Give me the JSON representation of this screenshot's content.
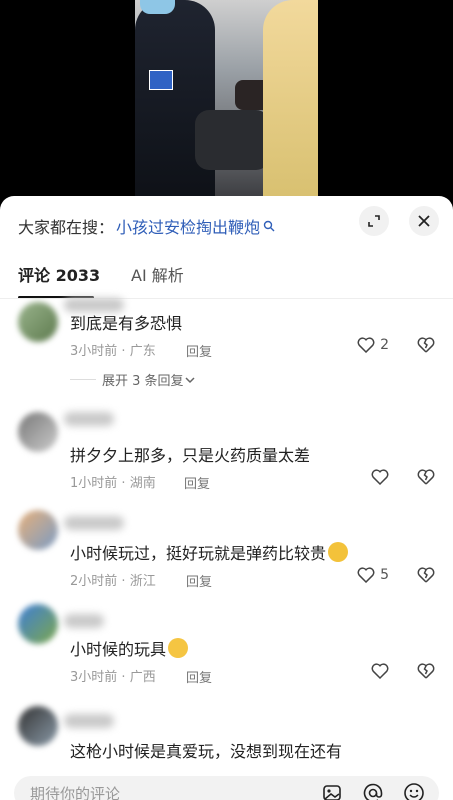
{
  "video": {
    "description_icon": "video-frame"
  },
  "search": {
    "prefix": "大家都在搜：",
    "term": "小孩过安检掏出鞭炮"
  },
  "tabs": [
    {
      "label": "评论 2033",
      "active": true
    },
    {
      "label": "AI 解析",
      "active": false
    }
  ],
  "comments": [
    {
      "text": "到底是有多恐惧",
      "time": "3小时前",
      "location": "广东",
      "reply": "回复",
      "likes": "2",
      "expand": "展开 3 条回复"
    },
    {
      "text": "拼夕夕上那多，只是火药质量太差",
      "time": "1小时前",
      "location": "湖南",
      "reply": "回复",
      "likes": ""
    },
    {
      "text": "小时候玩过，挺好玩就是弹药比较贵",
      "time": "2小时前",
      "location": "浙江",
      "reply": "回复",
      "likes": "5"
    },
    {
      "text": "小时候的玩具",
      "time": "3小时前",
      "location": "广西",
      "reply": "回复",
      "likes": ""
    },
    {
      "text": "这枪小时候是真爱玩，没想到现在还有",
      "time": "",
      "location": "",
      "reply": "",
      "likes": ""
    }
  ],
  "meta_sep": " · ",
  "input": {
    "placeholder": "期待你的评论"
  },
  "colors": {
    "link": "#2f5eb8",
    "meta": "#999999"
  }
}
